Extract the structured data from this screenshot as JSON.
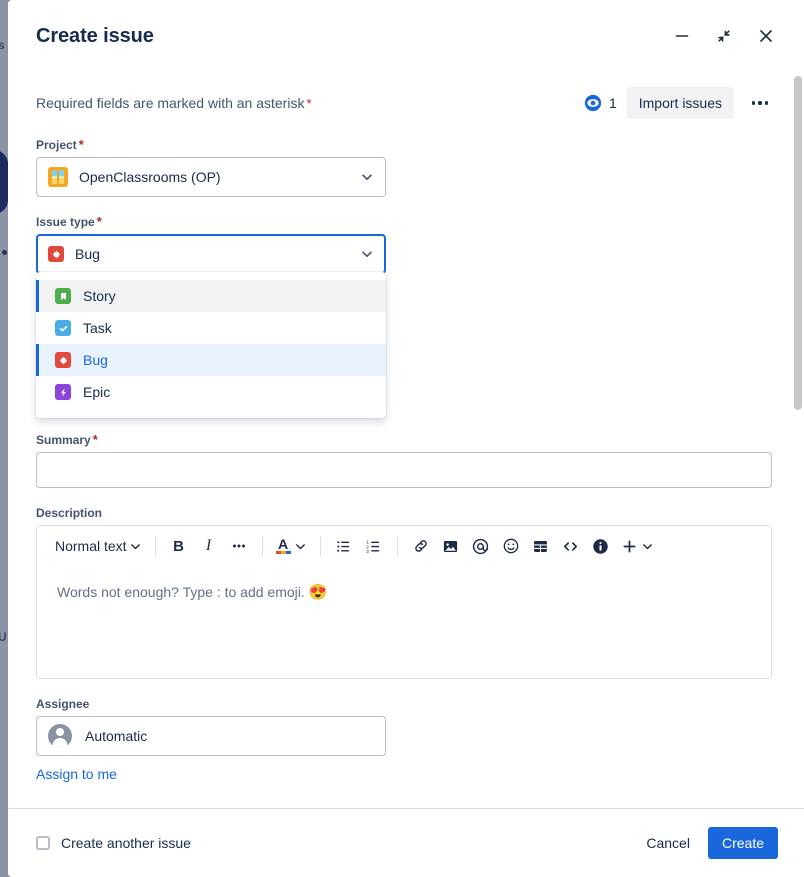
{
  "background": {
    "fragment_top": "s",
    "fragment_mid": "U"
  },
  "header": {
    "title": "Create issue",
    "minimize_label": "Minimize",
    "collapse_label": "Collapse",
    "close_label": "Close"
  },
  "toolbar_row": {
    "required_note": "Required fields are marked with an asterisk",
    "asterisk": "*",
    "watch_count": "1",
    "import_label": "Import issues",
    "more_label": "More actions"
  },
  "fields": {
    "project": {
      "label": "Project",
      "required": "*",
      "value": "OpenClassrooms (OP)",
      "avatar_icon": "project-avatar-icon"
    },
    "issue_type": {
      "label": "Issue type",
      "required": "*",
      "value": "Bug",
      "icon": "bug-icon",
      "focused": true,
      "options": [
        {
          "label": "Story",
          "icon": "story-icon",
          "state": "hovered"
        },
        {
          "label": "Task",
          "icon": "task-icon",
          "state": "normal"
        },
        {
          "label": "Bug",
          "icon": "bug-icon",
          "state": "selected"
        },
        {
          "label": "Epic",
          "icon": "epic-icon",
          "state": "normal"
        }
      ]
    },
    "summary": {
      "label": "Summary",
      "required": "*",
      "value": "",
      "placeholder": ""
    },
    "description": {
      "label": "Description",
      "placeholder": "Words not enough? Type : to add emoji.",
      "placeholder_emoji": "😍",
      "toolbar": {
        "text_style": "Normal text",
        "bold": "B",
        "italic": "I",
        "more_formatting": "More formatting options",
        "text_color": "A",
        "bullet_list": "Bulleted list",
        "numbered_list": "Numbered list",
        "link": "Link",
        "image": "Image",
        "mention": "Mention",
        "emoji": "Emoji",
        "table": "Table",
        "code": "Code snippet",
        "info_panel": "Info panel",
        "insert": "Insert more"
      }
    },
    "assignee": {
      "label": "Assignee",
      "value": "Automatic",
      "avatar_icon": "user-avatar-icon",
      "assign_link": "Assign to me"
    }
  },
  "footer": {
    "create_another_label": "Create another issue",
    "create_another_checked": false,
    "cancel_label": "Cancel",
    "create_label": "Create"
  },
  "colors": {
    "primary": "#1868DB",
    "bug": "#E2483D",
    "story": "#4BAD4B",
    "task": "#4BADE8",
    "epic": "#8B46D9",
    "required_asterisk": "#AE2A19",
    "project_avatar": "#F5A623"
  }
}
